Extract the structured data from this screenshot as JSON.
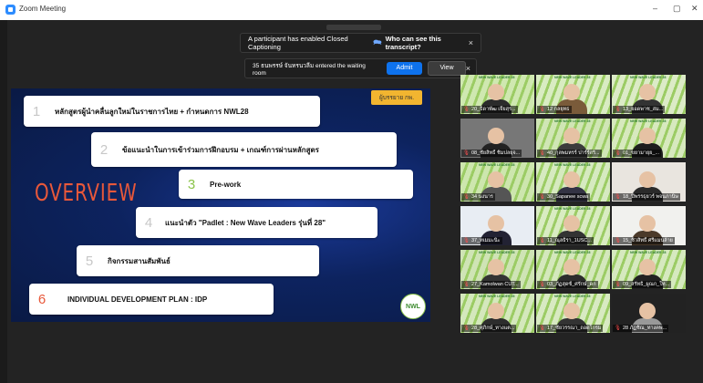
{
  "window": {
    "title": "Zoom Meeting",
    "minimize": "–",
    "maximize": "▢",
    "close": "✕"
  },
  "cc_banner": {
    "text": "A participant has enabled Closed Captioning",
    "link": "Who can see this transcript?",
    "close": "×"
  },
  "waiting_banner": {
    "text": "35 ธนพรรษ์ จันทรนวลีม entered the waiting room",
    "admit": "Admit",
    "view": "View",
    "close": "×"
  },
  "slide": {
    "overview": "OVERVIEW",
    "badge": "ผู้บรรยาย กพ.",
    "logo_text": "NWL",
    "items": [
      {
        "num": "1",
        "text": "หลักสูตรผู้นำคลื่นลูกใหม่ในราชการไทย + กำหนดการ NWL28"
      },
      {
        "num": "2",
        "text": "ข้อแนะนำในการเข้าร่วมการฝึกอบรม + เกณฑ์การผ่านหลักสูตร"
      },
      {
        "num": "3",
        "text": "Pre-work"
      },
      {
        "num": "4",
        "text": "แนะนำตัว \"Padlet : New Wave Leaders รุ่นที่ 28\""
      },
      {
        "num": "5",
        "text": "กิจกรรมสานสัมพันธ์"
      },
      {
        "num": "6",
        "text": "INDIVIDUAL DEVELOPMENT PLAN : IDP"
      }
    ]
  },
  "tile_header": "NEW WAVE LEADER 28",
  "participants": [
    {
      "label": "20_ธิดาพัฒ เจิ้ยสุร..."
    },
    {
      "label": "12 กลยุทธ"
    },
    {
      "label": "13_ยอดพาช_สม..."
    },
    {
      "label": "08_ชัยสิทธิ์ ชิมปลยุจ..."
    },
    {
      "label": "40_กุลพมหรร์ ปาร์ร์สริ..."
    },
    {
      "label": "01_ขยามายุย_..."
    },
    {
      "label": "34 นงนาร"
    },
    {
      "label": "30_Sapanee scwa"
    },
    {
      "label": "18_ปีพรรธุยวร์ พจนภานิษ"
    },
    {
      "label": "37_ทเมมะนิะ"
    },
    {
      "label": "11_ณุลธิรา_1USC..."
    },
    {
      "label": "15_ชิวสิทธิ์ ศรีแมนล้าย"
    },
    {
      "label": "27_Kamolwan CUT..."
    },
    {
      "label": "03_ภัฏสุดซ์_ศรักษ์_ดก"
    },
    {
      "label": "09_สรัทธิ_ผูณก_ใท..."
    },
    {
      "label": "28_ศุภิกษ์_ทางแต..."
    },
    {
      "label": "17_ชัยวรรณา_ถอดโกรม"
    },
    {
      "label": "28 ภัฏชิณ_ทางคพ..."
    }
  ]
}
